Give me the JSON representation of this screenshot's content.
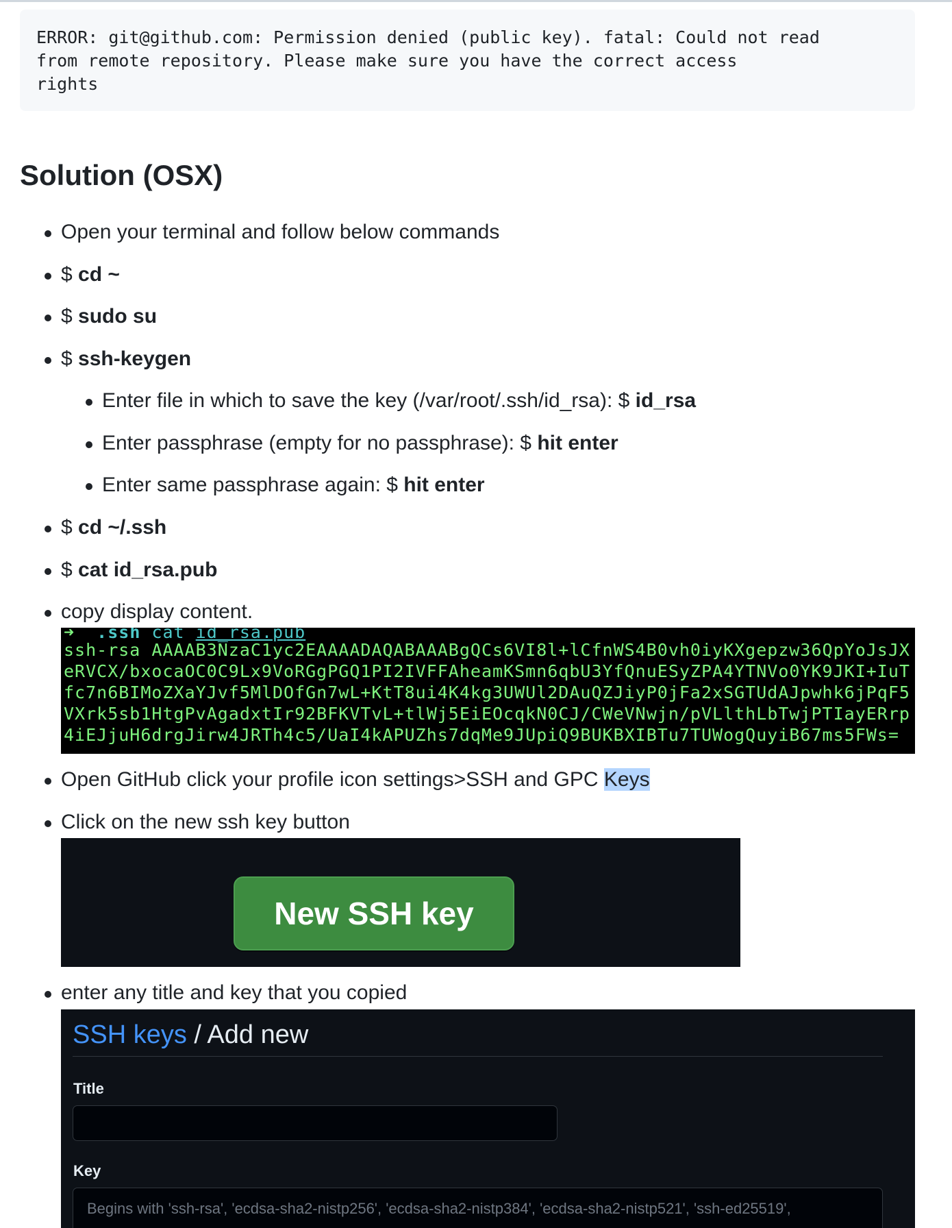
{
  "error": {
    "text": "ERROR: git@github.com: Permission denied (public key). fatal: Could not read\nfrom remote repository. Please make sure you have the correct access\nrights"
  },
  "heading": "Solution (OSX)",
  "steps": {
    "open_terminal": "Open your terminal and follow below commands",
    "prefix": "$ ",
    "cd_home": "cd ~",
    "sudo": "sudo su",
    "keygen": "ssh-keygen",
    "enter_file": {
      "text": "Enter file in which to save the key (/var/root/.ssh/id_rsa): $ ",
      "cmd": "id_rsa"
    },
    "enter_pass": {
      "text": "Enter passphrase (empty for no passphrase): $ ",
      "cmd": "hit enter"
    },
    "enter_same": {
      "text": "Enter same passphrase again: $ ",
      "cmd": "hit enter"
    },
    "cd_ssh": "cd ~/.ssh",
    "cat_pub": "cat id_rsa.pub",
    "copy": "copy display content.",
    "open_github": {
      "text": "Open GitHub click your profile icon settings>SSH and GPC ",
      "highlight": "Keys"
    },
    "click_new": "Click on the new ssh key button",
    "enter_title": "enter any title and key that you copied"
  },
  "terminal": {
    "prompt": "➜",
    "dir": ".ssh",
    "cmd": "cat",
    "arg": "id_rsa.pub",
    "lines": [
      "ssh-rsa AAAAB3NzaC1yc2EAAAADAQABAAABgQCs6VI8l+lCfnWS4B0vh0iyKXgepzw36QpYoJsJX",
      "eRVCX/bxocaOC0C9Lx9VoRGgPGQ1PI2IVFFAheamKSmn6qbU3YfQnuESyZPA4YTNVo0YK9JKI+IuT",
      "fc7n6BIMoZXaYJvf5MlDOfGn7wL+KtT8ui4K4kg3UWUl2DAuQZJiyP0jFa2xSGTUdAJpwhk6jPqF5",
      "VXrk5sb1HtgPvAgadxtIr92BFKVTvL+tlWj5EiEOcqkN0CJ/CWeVNwjn/pVLlthLbTwjPTIayERrp",
      "4iEJjuH6drgJirw4JRTh4c5/UaI4kAPUZhs7dqMe9JUpiQ9BUKBXIBTu7TUWogQuyiB67ms5FWs="
    ]
  },
  "new_key_button": {
    "label": "New SSH key",
    "color": "#3d8c40"
  },
  "add_key_form": {
    "breadcrumb_link": "SSH keys",
    "breadcrumb_rest": " / Add new",
    "title_label": "Title",
    "title_value": "",
    "key_label": "Key",
    "key_placeholder": "Begins with 'ssh-rsa', 'ecdsa-sha2-nistp256', 'ecdsa-sha2-nistp384', 'ecdsa-sha2-nistp521', 'ssh-ed25519',"
  }
}
